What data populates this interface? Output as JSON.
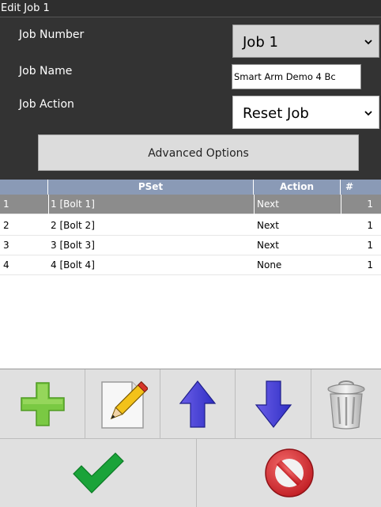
{
  "window": {
    "title": "Edit Job 1"
  },
  "form": {
    "job_number_label": "Job Number",
    "job_number_value": "Job 1",
    "job_name_label": "Job Name",
    "job_name_value": "Smart Arm Demo 4 Bc",
    "job_action_label": "Job Action",
    "job_action_value": "Reset Job",
    "advanced_button": "Advanced Options"
  },
  "grid": {
    "columns": [
      "",
      "PSet",
      "Action",
      "#"
    ],
    "rows": [
      {
        "idx": "1",
        "pset": "1 [Bolt 1]",
        "action": "Next",
        "count": "1",
        "selected": true
      },
      {
        "idx": "2",
        "pset": "2 [Bolt 2]",
        "action": "Next",
        "count": "1"
      },
      {
        "idx": "3",
        "pset": "3 [Bolt 3]",
        "action": "Next",
        "count": "1"
      },
      {
        "idx": "4",
        "pset": "4 [Bolt 4]",
        "action": "None",
        "count": "1"
      }
    ]
  },
  "toolbar": {
    "icons": [
      "add-icon",
      "edit-pencil-icon",
      "move-up-arrow-icon",
      "move-down-arrow-icon",
      "trash-icon"
    ]
  },
  "bottom": {
    "icons": [
      "confirm-check-icon",
      "cancel-icon"
    ]
  },
  "colors": {
    "form_bg": "#333333",
    "grid_header": "#8a9ab6",
    "selected_row": "#8c8c8c",
    "add_green": "#7ac943",
    "arrow_blue": "#3b3bd6",
    "check_green": "#1aa339",
    "cancel_red": "#d9282f"
  }
}
